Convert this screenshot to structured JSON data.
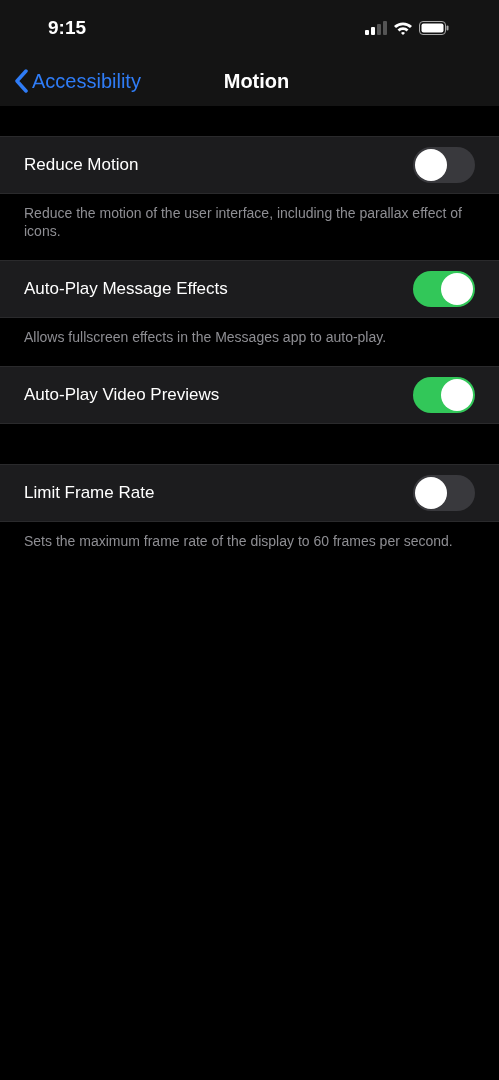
{
  "status_bar": {
    "time": "9:15"
  },
  "nav": {
    "back": "Accessibility",
    "title": "Motion"
  },
  "groups": [
    {
      "label": "Reduce Motion",
      "on": false,
      "footer": "Reduce the motion of the user interface, including the parallax effect of icons."
    },
    {
      "label": "Auto-Play Message Effects",
      "on": true,
      "footer": "Allows fullscreen effects in the Messages app to auto-play."
    },
    {
      "label": "Auto-Play Video Previews",
      "on": true
    },
    {
      "label": "Limit Frame Rate",
      "on": false,
      "footer": "Sets the maximum frame rate of the display to 60 frames per second."
    }
  ]
}
